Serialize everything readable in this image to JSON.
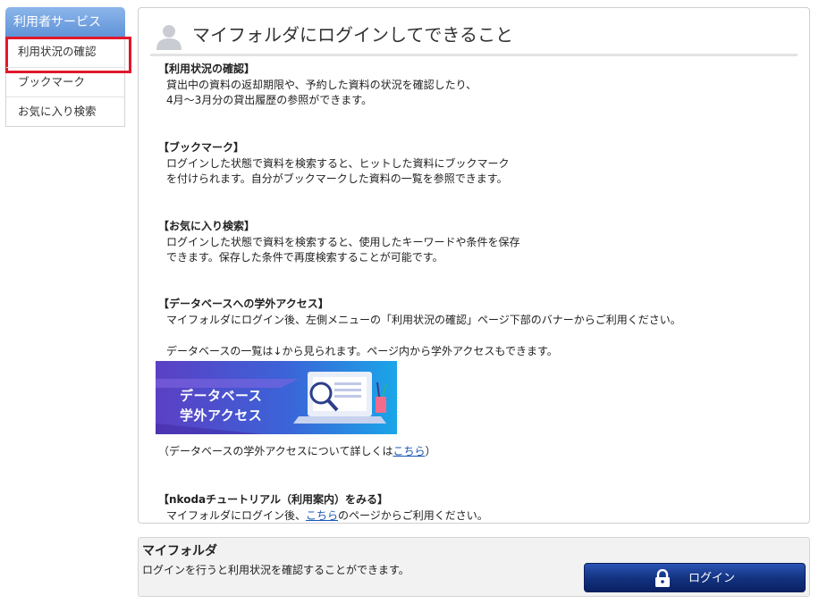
{
  "sidebar": {
    "header": "利用者サービス",
    "items": [
      {
        "label": "利用状況の確認",
        "active": true
      },
      {
        "label": "ブックマーク"
      },
      {
        "label": "お気に入り検索"
      }
    ]
  },
  "main": {
    "title": "マイフォルダにログインしてできること",
    "sections": {
      "usage": {
        "title": "【利用状況の確認】",
        "lines": [
          "貸出中の資料の返却期限や、予約した資料の状況を確認したり、",
          "4月～3月分の貸出履歴の参照ができます。"
        ]
      },
      "bookmark": {
        "title": "【ブックマーク】",
        "lines": [
          "ログインした状態で資料を検索すると、ヒットした資料にブックマーク",
          "を付けられます。自分がブックマークした資料の一覧を参照できます。"
        ]
      },
      "favorite": {
        "title": "【お気に入り検索】",
        "lines": [
          "ログインした状態で資料を検索すると、使用したキーワードや条件を保存",
          "できます。保存した条件で再度検索することが可能です。"
        ]
      },
      "database": {
        "title": "【データベースへの学外アクセス】",
        "line1": "マイフォルダにログイン後、左側メニューの「利用状況の確認」ページ下部のバナーからご利用ください。",
        "line2": "データベースの一覧は↓から見られます。ページ内から学外アクセスもできます。",
        "banner": {
          "line1": "データベース",
          "line2": "学外アクセス"
        },
        "note_prefix": "（データベースの学外アクセスについて詳しくは",
        "note_link": "こちら",
        "note_suffix": "）"
      },
      "tutorial": {
        "title": "【nkodaチュートリアル（利用案内）をみる】",
        "line_prefix": "マイフォルダにログイン後、",
        "line_link": "こちら",
        "line_suffix": "のページからご利用ください。"
      }
    }
  },
  "bottom": {
    "title": "マイフォルダ",
    "description": "ログインを行うと利用状況を確認することができます。",
    "login_label": "ログイン"
  },
  "colors": {
    "sidebar_header": "#6f9fe0",
    "active_outline": "#e0182b",
    "link": "#1a56b6",
    "login_button": "#12317e",
    "banner_start": "#5b3fc4",
    "banner_end": "#1aa6e8"
  },
  "icons": {
    "title": "user-silhouette-icon",
    "login": "lock-icon",
    "banner": "magnifier-laptop-illustration"
  }
}
